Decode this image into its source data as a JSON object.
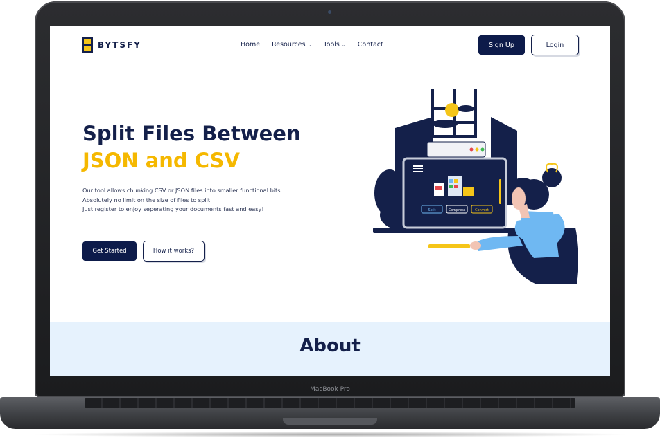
{
  "device": {
    "label": "MacBook Pro"
  },
  "brand": {
    "name": "BYTSFY"
  },
  "nav": {
    "items": [
      {
        "label": "Home",
        "has_dropdown": false
      },
      {
        "label": "Resources",
        "has_dropdown": true
      },
      {
        "label": "Tools",
        "has_dropdown": true
      },
      {
        "label": "Contact",
        "has_dropdown": false
      }
    ],
    "caret": "⌄",
    "signup_label": "Sign Up",
    "login_label": "Login"
  },
  "hero": {
    "title_line1": "Split Files Between",
    "title_line2": "JSON and CSV",
    "description_line1": "Our tool allows chunking CSV or JSON files into smaller functional bits.",
    "description_line2": "Absolutely no limit on the size of files to split.",
    "description_line3": "Just register to enjoy seperating your documents fast and easy!",
    "cta_primary": "Get Started",
    "cta_secondary": "How it works?"
  },
  "illustration": {
    "buttons": [
      "Split",
      "Compress",
      "Convert"
    ]
  },
  "about": {
    "title": "About"
  },
  "colors": {
    "navy": "#14204a",
    "accent_yellow": "#f5b800",
    "about_bg": "#e6f2fd",
    "illustration_blue": "#6fb8f2"
  }
}
